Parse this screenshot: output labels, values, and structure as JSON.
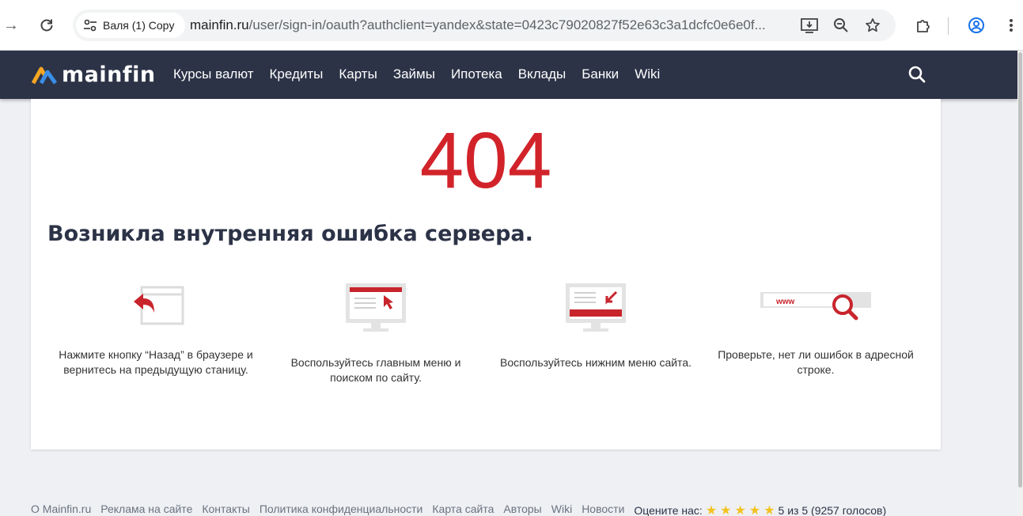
{
  "browser": {
    "tab_chip_label": "Валя (1) Copy",
    "url_main": "mainfin.ru",
    "url_rest": "/user/sign-in/oauth?authclient=yandex&state=0423c79020827f52e63c3a1dcfc0e6e0f..."
  },
  "header": {
    "logo_text": "mainfin",
    "nav": [
      "Курсы валют",
      "Кредиты",
      "Карты",
      "Займы",
      "Ипотека",
      "Вклады",
      "Банки",
      "Wiki"
    ]
  },
  "error": {
    "code": "404",
    "message": "Возникла внутренняя ошибка сервера."
  },
  "tips": [
    {
      "icon": "back-arrow-icon",
      "text": "Нажмите кнопку “Назад” в браузере и вернитесь на предыдущую станицу."
    },
    {
      "icon": "monitor-menu-icon",
      "text": "Воспользуйтесь главным меню и поиском по сайту."
    },
    {
      "icon": "monitor-footer-icon",
      "text": "Воспользуйтесь нижним меню сайта."
    },
    {
      "icon": "address-search-icon",
      "text": "Проверьте, нет ли ошибок в адресной строке.",
      "badge": "www"
    }
  ],
  "footer": {
    "links": [
      "О Mainfin.ru",
      "Реклама на сайте",
      "Контакты",
      "Политика конфиденциальности",
      "Карта сайта",
      "Авторы",
      "Wiki",
      "Новости"
    ],
    "rating_label": "Оцените нас:",
    "rating_value": 5,
    "rating_text": "5 из 5 (9257 голосов)"
  },
  "colors": {
    "accent_red": "#d2232a",
    "header_bg": "#2c3347",
    "star": "#f4c21f",
    "logo_orange": "#f5a623",
    "logo_blue": "#3a8ee6"
  }
}
